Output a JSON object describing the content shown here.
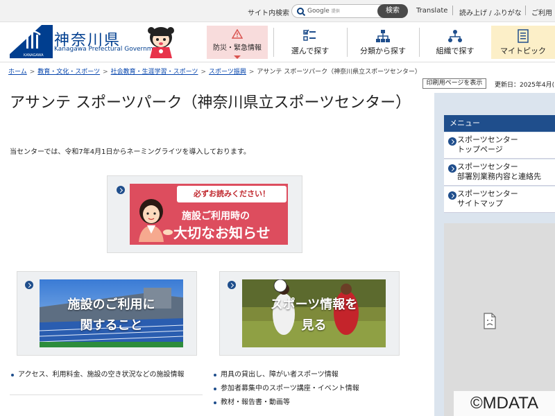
{
  "topbar": {
    "site_search_label": "サイト内検索",
    "search_placeholder": "Google",
    "search_placeholder_sub": "提供",
    "search_button": "検索",
    "translate": "Translate",
    "read_aloud": "読み上げ / ふりがな",
    "contact": "ご利用"
  },
  "header": {
    "logo_title": "神奈川県",
    "logo_subtitle": "Kanagawa Prefectural Government",
    "logo_mark_text": "KANAGAWA",
    "nav": [
      {
        "label": "防災・緊急情報",
        "icon": "warning-icon"
      },
      {
        "label": "選んで探す",
        "icon": "checklist-icon"
      },
      {
        "label": "分類から探す",
        "icon": "hierarchy-icon"
      },
      {
        "label": "組織で探す",
        "icon": "org-icon"
      },
      {
        "label": "マイトピック",
        "icon": "document-icon"
      }
    ]
  },
  "breadcrumb": {
    "items": [
      "ホーム",
      "教育・文化・スポーツ",
      "社会教育・生涯学習・スポーツ",
      "スポーツ振興"
    ],
    "current": "アサンテ スポーツパーク（神奈川県立スポーツセンター）"
  },
  "toolbar": {
    "print_label": "印刷用ページを表示",
    "updated": "更新日：2025年4月("
  },
  "main": {
    "title": "アサンテ スポーツパーク（神奈川県立スポーツセンター）",
    "intro": "当センターでは、令和7年4月1日からネーミングライツを導入しております。",
    "notice": {
      "tag": "必ずお読みください！",
      "line1": "施設ご利用時の",
      "line2": "大切なお知らせ"
    },
    "card_facility": {
      "image_text_1": "施設のご利用に",
      "image_text_2": "関すること",
      "bullets": [
        "アクセス、利用料金、施設の空き状況などの施設情報"
      ]
    },
    "card_sports": {
      "image_text_1": "スポーツ情報を",
      "image_text_2": "見る",
      "bullets": [
        "用具の貸出し、障がい者スポーツ情報",
        "参加者募集中のスポーツ講座・イベント情報",
        "教材・報告書・動画等"
      ]
    }
  },
  "sidebar": {
    "menu_title": "メニュー",
    "items": [
      {
        "line1": "スポーツセンター",
        "line2": "トップページ"
      },
      {
        "line1": "スポーツセンター",
        "line2": "部署別業務内容と連絡先"
      },
      {
        "line1": "スポーツセンター",
        "line2": "サイトマップ"
      }
    ]
  },
  "watermark": "©MDATA",
  "colors": {
    "brand_blue": "#1f4e8c",
    "logo_blue": "#003e8f",
    "emergency_bg": "#f8dcdc",
    "mypick_bg": "#fcefc8",
    "notice_red": "#dd4d5e"
  }
}
